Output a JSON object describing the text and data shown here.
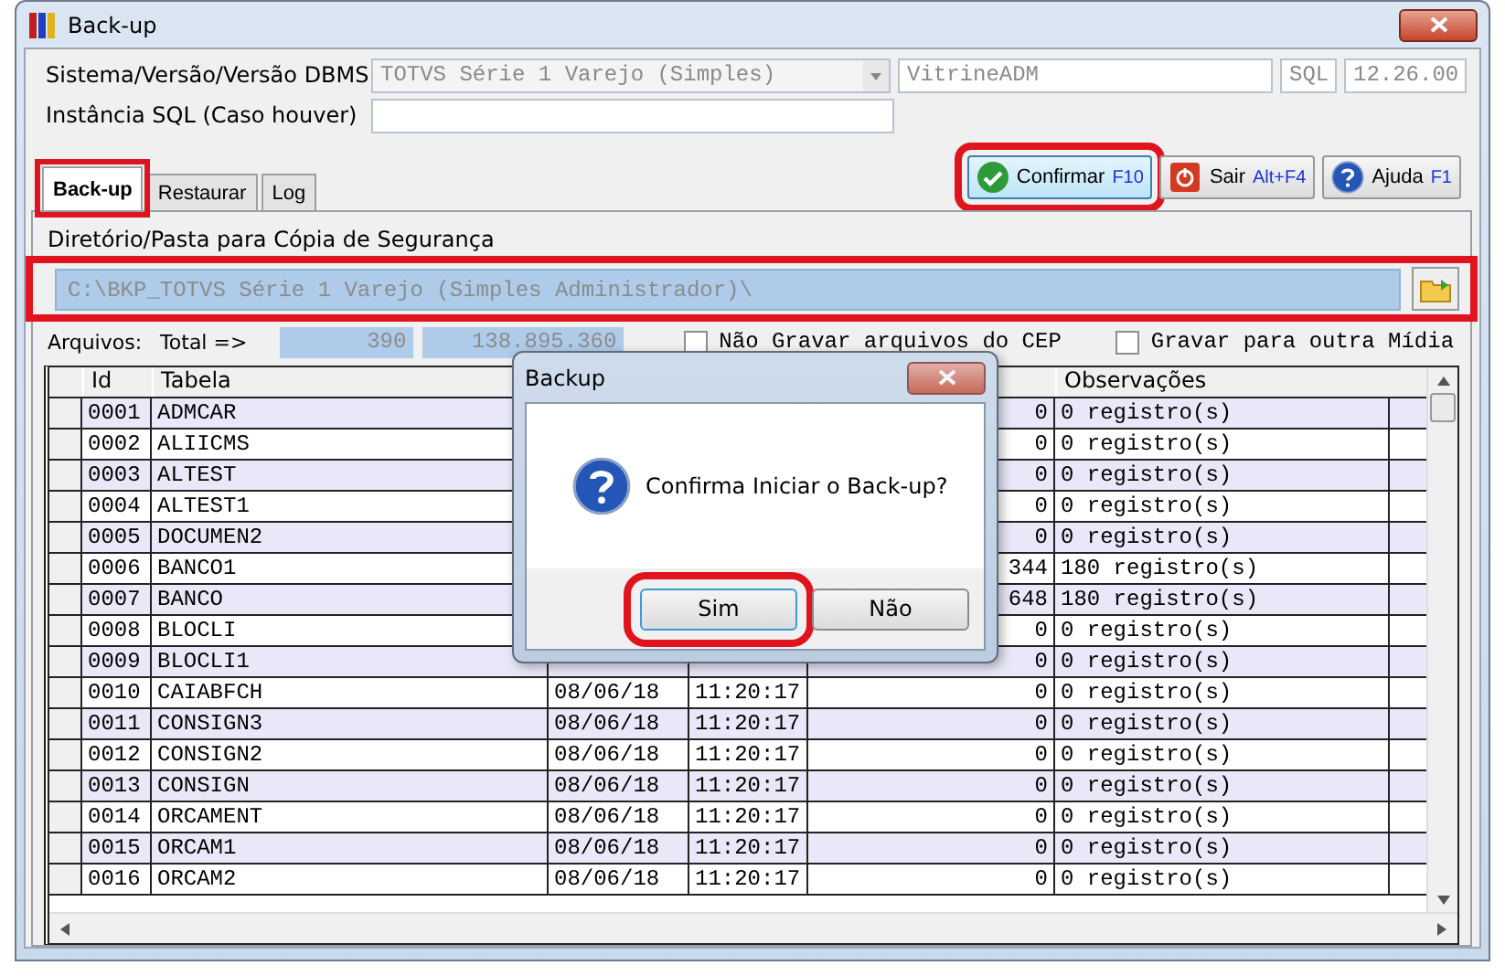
{
  "window": {
    "title": "Back-up"
  },
  "form": {
    "system_label": "Sistema/Versão/Versão DBMS",
    "system_value": "TOTVS Série 1 Varejo (Simples)",
    "database": "VitrineADM",
    "dbms": "SQL",
    "version": "12.26.00",
    "instance_label": "Instância SQL (Caso houver)"
  },
  "tabs": [
    {
      "label": "Back-up",
      "selected": true
    },
    {
      "label": "Restaurar",
      "selected": false
    },
    {
      "label": "Log",
      "selected": false
    }
  ],
  "toolbar": [
    {
      "kind": "confirm",
      "label": "Confirmar",
      "shortcut": "F10"
    },
    {
      "kind": "exit",
      "label": "Sair",
      "shortcut": "Alt+F4"
    },
    {
      "kind": "help",
      "label": "Ajuda",
      "shortcut": "F1"
    }
  ],
  "directory": {
    "label": "Diretório/Pasta para Cópia de Segurança",
    "value": "C:\\BKP_TOTVS Série 1 Varejo (Simples Administrador)\\"
  },
  "totals": {
    "label": "Arquivos:",
    "total_label": "Total =>",
    "files": "390",
    "bytes": "138.895.360"
  },
  "options": [
    {
      "label": "Não Gravar arquivos do CEP",
      "checked": false
    },
    {
      "label": "Gravar para outra Mídia",
      "checked": false
    }
  ],
  "table": {
    "columns": [
      "Id",
      "Tabela",
      "",
      "",
      "",
      "Observações"
    ],
    "rows": [
      {
        "id": "0001",
        "table": "ADMCAR",
        "size": "0",
        "notes": "0 registro(s)"
      },
      {
        "id": "0002",
        "table": "ALIICMS",
        "size": "0",
        "notes": "0 registro(s)"
      },
      {
        "id": "0003",
        "table": "ALTEST",
        "size": "0",
        "notes": "0 registro(s)"
      },
      {
        "id": "0004",
        "table": "ALTEST1",
        "size": "0",
        "notes": "0 registro(s)"
      },
      {
        "id": "0005",
        "table": "DOCUMEN2",
        "size": "0",
        "notes": "0 registro(s)"
      },
      {
        "id": "0006",
        "table": "BANCO1",
        "size": "344",
        "notes": "180 registro(s)"
      },
      {
        "id": "0007",
        "table": "BANCO",
        "size": "648",
        "notes": "180 registro(s)"
      },
      {
        "id": "0008",
        "table": "BLOCLI",
        "size": "0",
        "notes": "0 registro(s)"
      },
      {
        "id": "0009",
        "table": "BLOCLI1",
        "size": "0",
        "notes": "0 registro(s)"
      },
      {
        "id": "0010",
        "table": "CAIABFCH",
        "date": "08/06/18",
        "time": "11:20:17",
        "size": "0",
        "notes": "0 registro(s)"
      },
      {
        "id": "0011",
        "table": "CONSIGN3",
        "date": "08/06/18",
        "time": "11:20:17",
        "size": "0",
        "notes": "0 registro(s)"
      },
      {
        "id": "0012",
        "table": "CONSIGN2",
        "date": "08/06/18",
        "time": "11:20:17",
        "size": "0",
        "notes": "0 registro(s)"
      },
      {
        "id": "0013",
        "table": "CONSIGN",
        "date": "08/06/18",
        "time": "11:20:17",
        "size": "0",
        "notes": "0 registro(s)"
      },
      {
        "id": "0014",
        "table": "ORCAMENT",
        "date": "08/06/18",
        "time": "11:20:17",
        "size": "0",
        "notes": "0 registro(s)"
      },
      {
        "id": "0015",
        "table": "ORCAM1",
        "date": "08/06/18",
        "time": "11:20:17",
        "size": "0",
        "notes": "0 registro(s)"
      },
      {
        "id": "0016",
        "table": "ORCAM2",
        "date": "08/06/18",
        "time": "11:20:17",
        "size": "0",
        "notes": "0 registro(s)"
      }
    ]
  },
  "dialog": {
    "title": "Backup",
    "message": "Confirma Iniciar o Back-up?",
    "buttons": [
      {
        "label": "Sim",
        "selected": true
      },
      {
        "label": "Não",
        "selected": false
      }
    ]
  }
}
